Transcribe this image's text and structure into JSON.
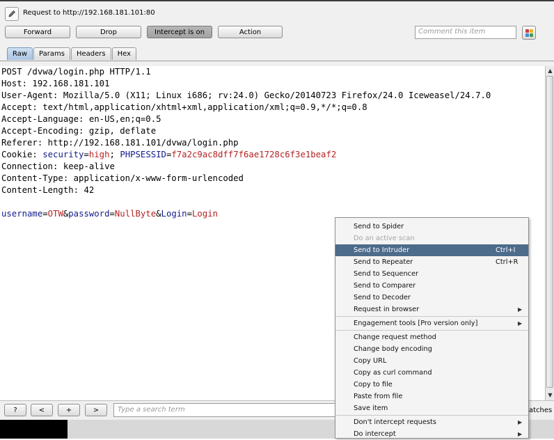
{
  "header": {
    "title": "Request to http://192.168.181.101:80",
    "buttons": {
      "forward": "Forward",
      "drop": "Drop",
      "intercept": "Intercept is on",
      "action": "Action"
    },
    "comment_placeholder": "Comment this item"
  },
  "tabs": [
    "Raw",
    "Params",
    "Headers",
    "Hex"
  ],
  "request": {
    "line1": "POST /dvwa/login.php HTTP/1.1",
    "line2": "Host: 192.168.181.101",
    "line3": "User-Agent: Mozilla/5.0 (X11; Linux i686; rv:24.0) Gecko/20140723 Firefox/24.0 Iceweasel/24.7.0",
    "line4": "Accept: text/html,application/xhtml+xml,application/xml;q=0.9,*/*;q=0.8",
    "line5": "Accept-Language: en-US,en;q=0.5",
    "line6": "Accept-Encoding: gzip, deflate",
    "line7": "Referer: http://192.168.181.101/dvwa/login.php",
    "cookie_label": "Cookie: ",
    "cookie_security_key": "security",
    "cookie_security_value": "high",
    "cookie_sess_key": "PHPSESSID",
    "cookie_sess_value": "f7a2c9ac8dff7f6ae1728c6f3e1beaf2",
    "line9": "Connection: keep-alive",
    "line10": "Content-Type: application/x-www-form-urlencoded",
    "line11": "Content-Length: 42",
    "body_user_key": "username",
    "body_user_value": "OTW",
    "body_pass_key": "password",
    "body_pass_value": "NullByte",
    "body_login_key": "Login",
    "body_login_value": "Login"
  },
  "search": {
    "help": "?",
    "prev": "<",
    "add": "+",
    "next": ">",
    "placeholder": "Type a search term",
    "matches": "atches"
  },
  "context_menu": {
    "items": [
      {
        "label": "Send to Spider"
      },
      {
        "label": "Do an active scan"
      },
      {
        "label": "Send to Intruder",
        "shortcut": "Ctrl+I"
      },
      {
        "label": "Send to Repeater",
        "shortcut": "Ctrl+R"
      },
      {
        "label": "Send to Sequencer"
      },
      {
        "label": "Send to Comparer"
      },
      {
        "label": "Send to Decoder"
      },
      {
        "label": "Request in browser"
      },
      {
        "label": "Engagement tools [Pro version only]"
      },
      {
        "label": "Change request method"
      },
      {
        "label": "Change body encoding"
      },
      {
        "label": "Copy URL"
      },
      {
        "label": "Copy as curl command"
      },
      {
        "label": "Copy to file"
      },
      {
        "label": "Paste from file"
      },
      {
        "label": "Save item"
      },
      {
        "label": "Don't intercept requests"
      },
      {
        "label": "Do intercept"
      }
    ]
  },
  "colors": {
    "key": "#121b8a",
    "value": "#b52222",
    "menu_highlight": "#4d6b8b"
  }
}
